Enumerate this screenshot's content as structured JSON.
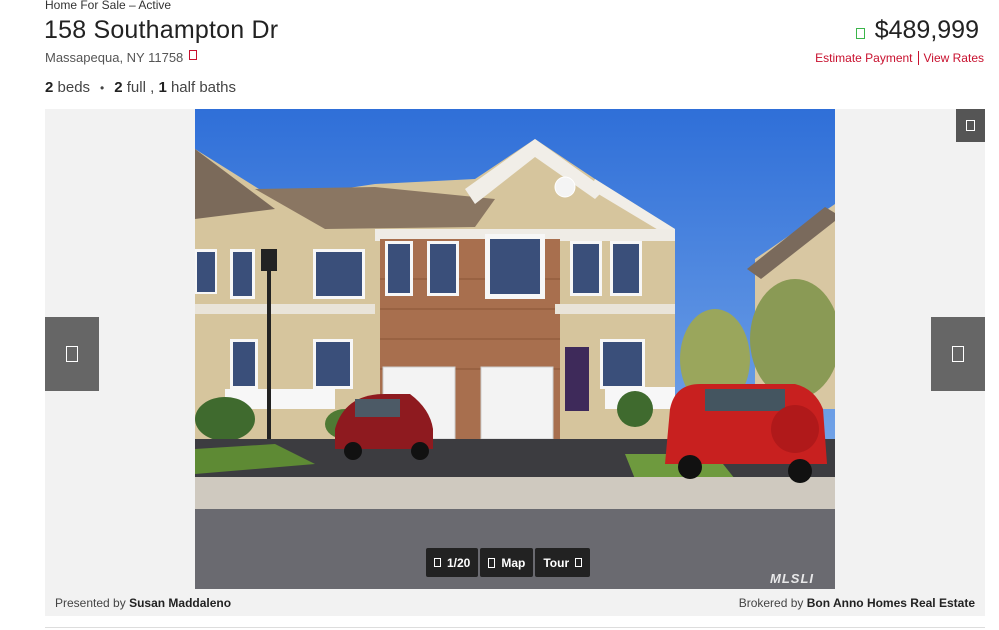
{
  "listing": {
    "status": "Home For Sale – Active",
    "address": "158 Southampton Dr",
    "city_state_zip": "Massapequa, NY 11758",
    "beds": "2",
    "beds_label": "beds",
    "full_baths": "2",
    "full_label": "full ,",
    "half_baths": "1",
    "half_label": "half baths",
    "price": "$489,999",
    "estimate_payment_label": "Estimate Payment",
    "view_rates_label": "View Rates"
  },
  "gallery": {
    "photo_counter": "1/20",
    "map_label": "Map",
    "tour_label": "Tour",
    "watermark": "MLSLI",
    "presented_by_prefix": "Presented by",
    "agent_name": "Susan Maddaleno",
    "brokered_by_prefix": "Brokered by",
    "broker_name": "Bon Anno Homes Real Estate"
  },
  "colors": {
    "accent_red": "#c8102e",
    "price_icon_green": "#3bb54a",
    "nav_gray": "#666666"
  }
}
